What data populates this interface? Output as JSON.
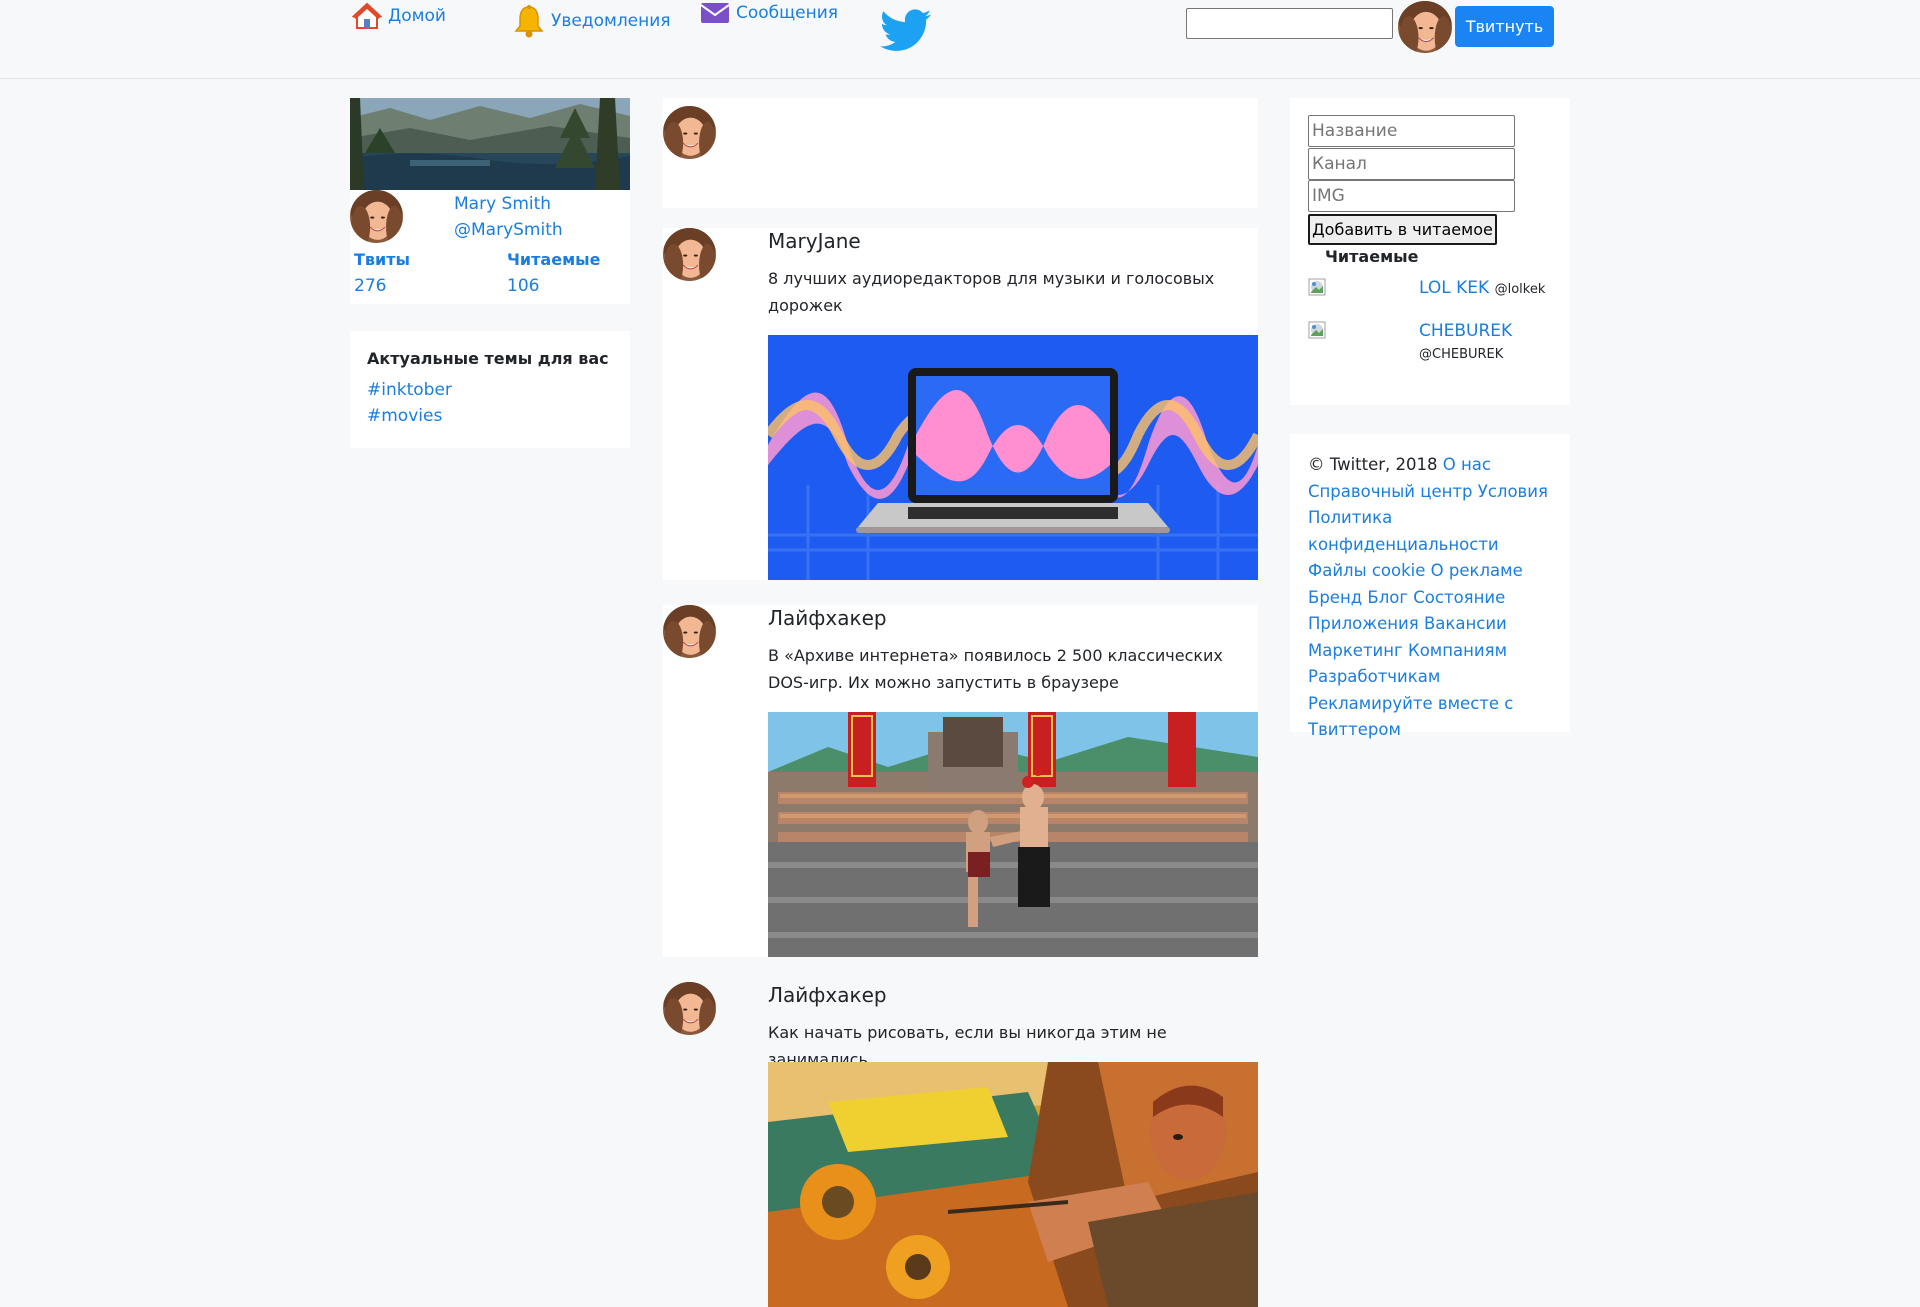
{
  "nav": {
    "home": "Домой",
    "notifications": "Уведомления",
    "messages": "Сообщения"
  },
  "header": {
    "search_value": "",
    "tweet_button": "Твитнуть"
  },
  "profile": {
    "name": "Mary Smith",
    "handle": "@MarySmith",
    "tweets_label": "Твиты",
    "tweets_count": "276",
    "following_label": "Читаемые",
    "following_count": "106"
  },
  "trends": {
    "title": "Актуальные темы для вас",
    "tags": [
      "#inktober",
      "#movies"
    ]
  },
  "tweets": [
    {
      "author": "MaryJane",
      "text": "8 лучших аудиоредакторов для музыки и голосовых дорожек",
      "media": "audio-editor-laptop-image"
    },
    {
      "author": "Лайфхакер",
      "text": "В «Архиве интернета» появилось 2 500 классических DOS-игр. Их можно запустить в браузере",
      "media": "dos-fighting-game-image"
    },
    {
      "author": "Лайфхакер",
      "text": "Как начать рисовать, если вы никогда этим не занимались",
      "media": "painting-artwork-image"
    }
  ],
  "follow_form": {
    "name_placeholder": "Название",
    "channel_placeholder": "Канал",
    "img_placeholder": "IMG",
    "submit": "Добавить в читаемое",
    "list_title": "Читаемые",
    "items": [
      {
        "name": "LOL KEK",
        "handle": "@lolkek"
      },
      {
        "name": "CHEBUREK",
        "handle": "@CHEBUREK"
      }
    ]
  },
  "footer": {
    "copyright": "© Twitter, 2018",
    "links": [
      "О нас",
      "Справочный центр",
      "Условия",
      "Политика конфиденциальности",
      "Файлы cookie",
      "О рекламе",
      "Бренд",
      "Блог",
      "Состояние",
      "Приложения",
      "Вакансии",
      "Маркетинг",
      "Компаниям",
      "Разработчикам",
      "Рекламируйте вместе с Твиттером"
    ]
  },
  "colors": {
    "accent": "#1a7ee0",
    "button": "#1b84f4",
    "background": "#f7f8fa"
  }
}
